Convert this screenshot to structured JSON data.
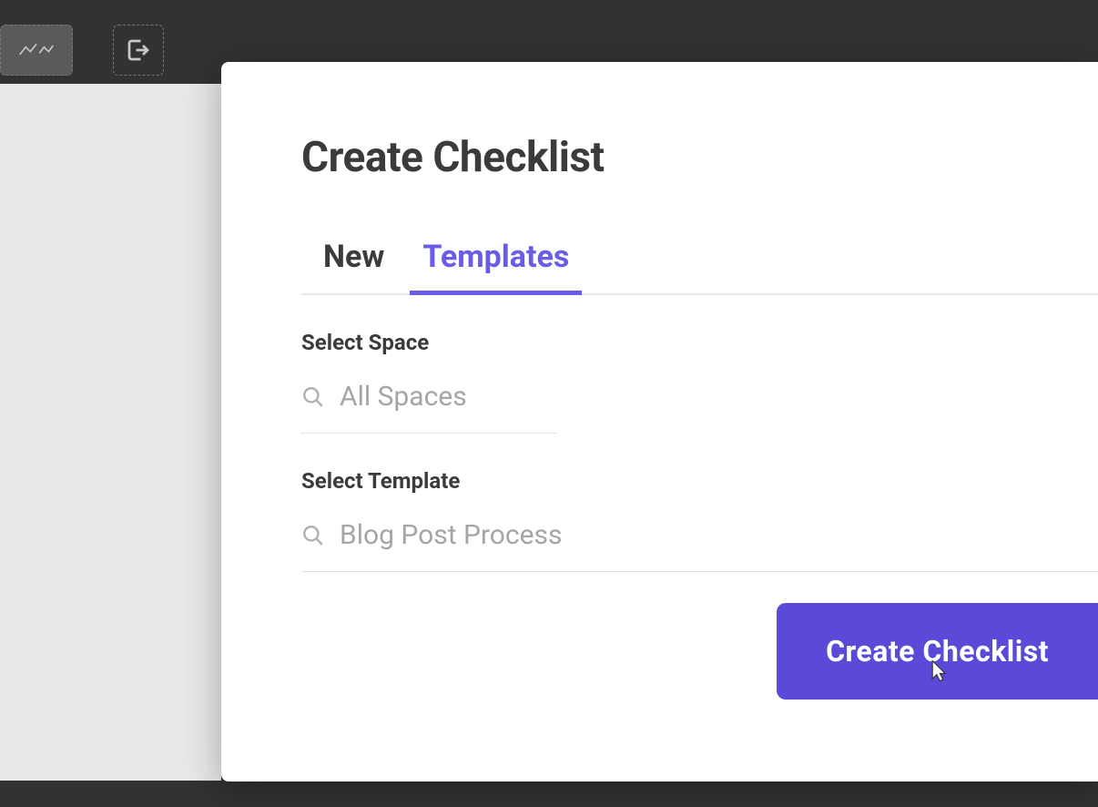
{
  "modal": {
    "title": "Create Checklist",
    "tabs": {
      "new": "New",
      "templates": "Templates",
      "active": "templates"
    },
    "sections": {
      "space": {
        "label": "Select Space",
        "placeholder": "All Spaces",
        "value": ""
      },
      "template": {
        "label": "Select Template",
        "placeholder": "Blog Post Process",
        "value": ""
      }
    },
    "button": {
      "label": "Create Checklist"
    }
  },
  "colors": {
    "accent": "#5b49d8",
    "tabActive": "#6b5ce7",
    "textDark": "#3b3b3b",
    "placeholder": "#a5a5a5"
  },
  "icons": {
    "search": "search-icon",
    "toolbarSignature": "chart-icon",
    "toolbarExit": "exit-icon"
  }
}
